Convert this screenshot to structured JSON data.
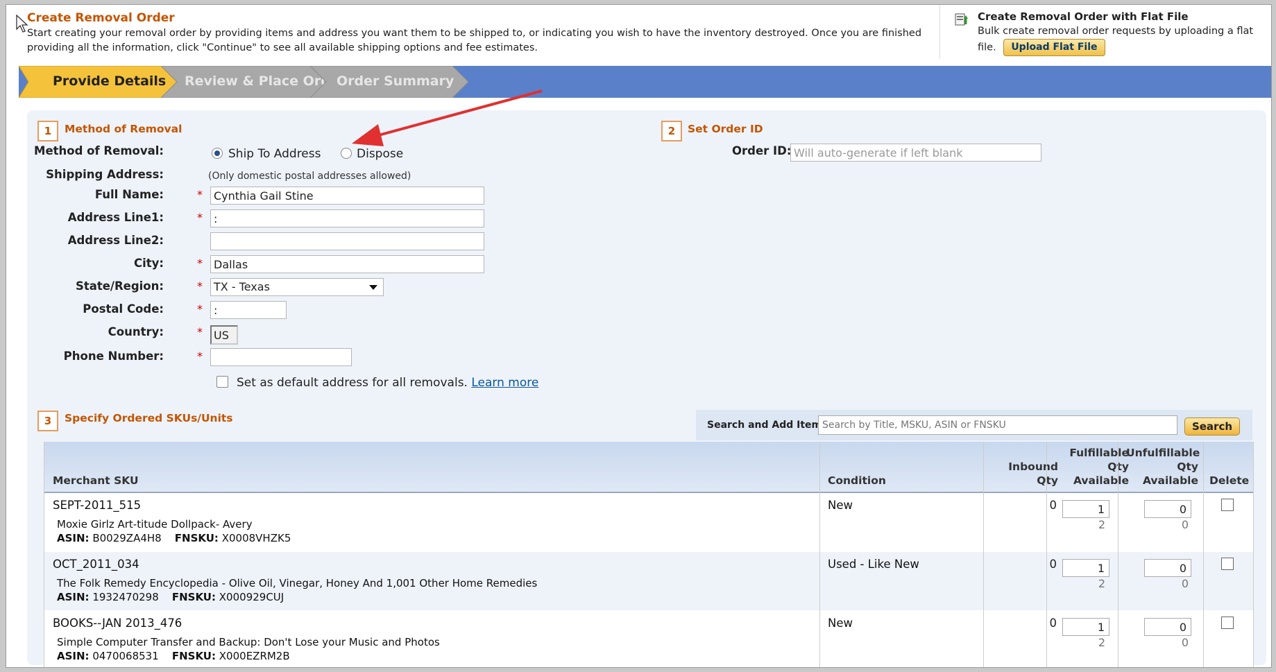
{
  "header": {
    "title": "Create Removal Order",
    "description": "Start creating your removal order by providing items and address you want them to be shipped to, or indicating you wish to have the inventory destroyed. Once you are finished providing all the information, click \"Continue\" to see all available shipping options and fee estimates.",
    "flat_file_title": "Create Removal Order with Flat File",
    "flat_file_desc": "Bulk create removal order requests by uploading a flat file.",
    "upload_button": "Upload Flat File"
  },
  "steps": [
    {
      "label": "Provide Details",
      "active": true
    },
    {
      "label": "Review & Place Order",
      "active": false
    },
    {
      "label": "Order Summary",
      "active": false
    }
  ],
  "section1": {
    "number": "1",
    "title": "Method of Removal",
    "method_label": "Method of Removal:",
    "option_ship": "Ship To Address",
    "option_dispose": "Dispose",
    "shipping_label": "Shipping Address:",
    "shipping_note": "(Only domestic postal addresses allowed)",
    "full_name_label": "Full Name:",
    "full_name_value": "Cynthia Gail Stine",
    "address1_label": "Address Line1:",
    "address1_value": ":",
    "address2_label": "Address Line2:",
    "address2_value": "",
    "city_label": "City:",
    "city_value": "Dallas",
    "state_label": "State/Region:",
    "state_value": "TX - Texas",
    "postal_label": "Postal Code:",
    "postal_value": ":",
    "country_label": "Country:",
    "country_value": "US",
    "phone_label": "Phone Number:",
    "phone_value": "",
    "required_mark": "*",
    "default_text": "Set as default address for all removals.",
    "learn_more": "Learn more"
  },
  "section2": {
    "number": "2",
    "title": "Set Order ID",
    "order_id_label": "Order ID:",
    "order_id_placeholder": "Will auto-generate if left blank"
  },
  "section3": {
    "number": "3",
    "title": "Specify Ordered SKUs/Units",
    "search_label": "Search and Add Items:",
    "search_placeholder": "Search by Title, MSKU, ASIN or FNSKU",
    "search_button": "Search"
  },
  "table": {
    "headers": {
      "sku": "Merchant SKU",
      "condition": "Condition",
      "inbound": [
        "Inbound",
        "Qty"
      ],
      "fulfillable": [
        "Fulfillable",
        "Qty",
        "Available"
      ],
      "unfulfillable": [
        "Unfulfillable",
        "Qty",
        "Available"
      ],
      "delete": "Delete"
    },
    "asin_label": "ASIN:",
    "fnsku_label": "FNSKU:",
    "rows": [
      {
        "sku": "SEPT-2011_515",
        "title": "Moxie Girlz Art-titude Dollpack- Avery",
        "asin": "B0029ZA4H8",
        "fnsku": "X0008VHZK5",
        "condition": "New",
        "inbound": "0",
        "fulfillable_qty": "1",
        "fulfillable_avail": "2",
        "unfulfillable_qty": "0",
        "unfulfillable_avail": "0"
      },
      {
        "sku": "OCT_2011_034",
        "title": "The Folk Remedy Encyclopedia - Olive Oil, Vinegar, Honey And 1,001 Other Home Remedies",
        "asin": "1932470298",
        "fnsku": "X000929CUJ",
        "condition": "Used - Like New",
        "inbound": "0",
        "fulfillable_qty": "1",
        "fulfillable_avail": "2",
        "unfulfillable_qty": "0",
        "unfulfillable_avail": "0"
      },
      {
        "sku": "BOOKS--JAN 2013_476",
        "title": "Simple Computer Transfer and Backup: Don't Lose your Music and Photos",
        "asin": "0470068531",
        "fnsku": "X000EZRM2B",
        "condition": "New",
        "inbound": "0",
        "fulfillable_qty": "1",
        "fulfillable_avail": "2",
        "unfulfillable_qty": "0",
        "unfulfillable_avail": "0"
      }
    ]
  },
  "colors": {
    "accent": "#c45500",
    "stepbar": "#5a80c9",
    "step_active": "#f5c23b",
    "step_inactive": "#a8a8a8",
    "annotation_arrow": "#e03030"
  }
}
